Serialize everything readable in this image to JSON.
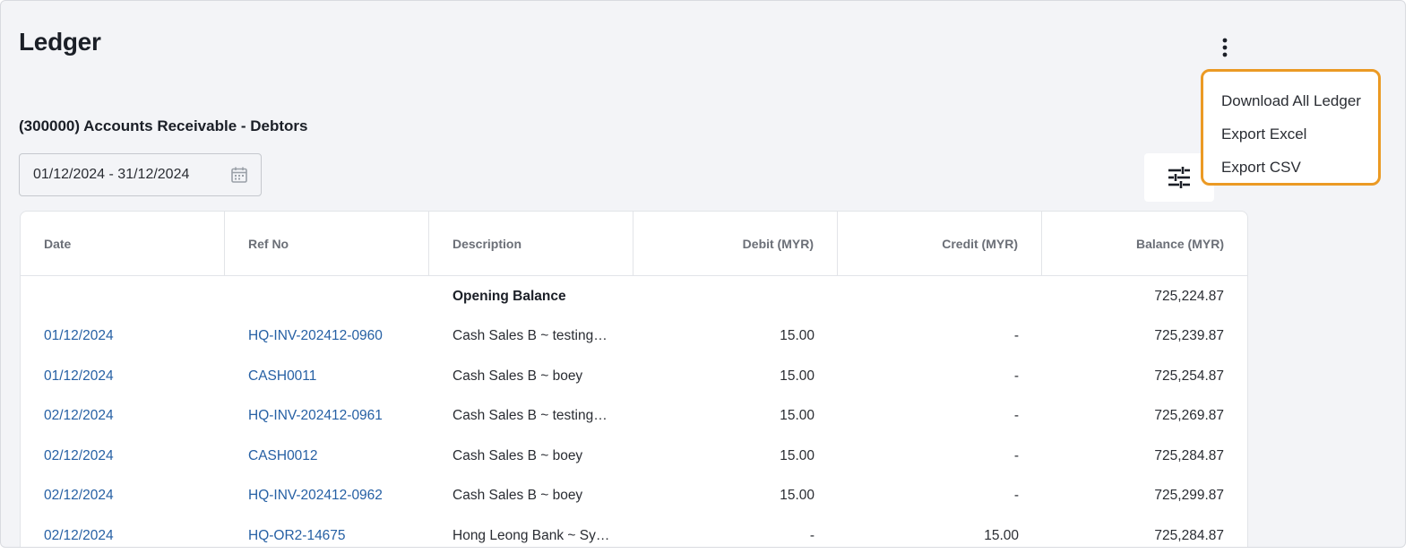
{
  "page": {
    "title": "Ledger",
    "account_title": "(300000) Accounts Receivable - Debtors"
  },
  "filters": {
    "date_range": "01/12/2024 - 31/12/2024"
  },
  "menu": {
    "items": [
      "Download All Ledger",
      "Export Excel",
      "Export CSV"
    ]
  },
  "table": {
    "columns": [
      "Date",
      "Ref No",
      "Description",
      "Debit (MYR)",
      "Credit (MYR)",
      "Balance (MYR)"
    ],
    "opening_balance": {
      "label": "Opening Balance",
      "balance": "725,224.87"
    },
    "rows": [
      {
        "date": "01/12/2024",
        "ref": "HQ-INV-202412-0960",
        "description": "Cash Sales B ~ testing…",
        "debit": "15.00",
        "credit": "-",
        "balance": "725,239.87"
      },
      {
        "date": "01/12/2024",
        "ref": "CASH0011",
        "description": "Cash Sales B ~ boey",
        "debit": "15.00",
        "credit": "-",
        "balance": "725,254.87"
      },
      {
        "date": "02/12/2024",
        "ref": "HQ-INV-202412-0961",
        "description": "Cash Sales B ~ testing…",
        "debit": "15.00",
        "credit": "-",
        "balance": "725,269.87"
      },
      {
        "date": "02/12/2024",
        "ref": "CASH0012",
        "description": "Cash Sales B ~ boey",
        "debit": "15.00",
        "credit": "-",
        "balance": "725,284.87"
      },
      {
        "date": "02/12/2024",
        "ref": "HQ-INV-202412-0962",
        "description": "Cash Sales B ~ boey",
        "debit": "15.00",
        "credit": "-",
        "balance": "725,299.87"
      },
      {
        "date": "02/12/2024",
        "ref": "HQ-OR2-14675",
        "description": "Hong Leong Bank ~ Sy…",
        "debit": "-",
        "credit": "15.00",
        "balance": "725,284.87"
      }
    ]
  },
  "icons": {
    "more": "more-vertical-icon",
    "calendar": "calendar-icon",
    "filter": "sliders-icon"
  },
  "colors": {
    "link": "#2660a4",
    "menu_border": "#eb9a24",
    "background": "#f3f4f7"
  }
}
